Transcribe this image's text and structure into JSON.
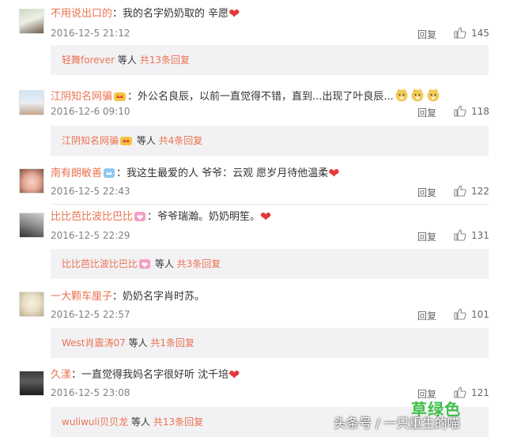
{
  "comments": [
    {
      "username": "不用说出口的",
      "text": "：我的名字奶奶取的  辛愿",
      "date": "2016-12-5 21:12",
      "reply_label": "回复",
      "likes": "145",
      "sub": {
        "name": "轻舞forever",
        "etc": " 等人 ",
        "count": "共13条回复"
      }
    },
    {
      "username": "江阴知名网骗",
      "text": "：外公名良辰，以前一直觉得不错，直到...出现了叶良辰...",
      "date": "2016-12-6 09:10",
      "reply_label": "回复",
      "likes": "118",
      "sub": {
        "name": "江阴知名网骗",
        "etc": " 等人 ",
        "count": "共4条回复"
      }
    },
    {
      "username": "南有朗敏善",
      "text": "：我这生最爱的人  爷爷：云观 愿岁月待他温柔",
      "date": "2016-12-5 22:43",
      "reply_label": "回复",
      "likes": "122"
    },
    {
      "username": "比比芭比波比巴比",
      "text": "：爷爷瑞瀚。奶奶明笙。",
      "date": "2016-12-5 22:29",
      "reply_label": "回复",
      "likes": "131",
      "sub": {
        "name": "比比芭比波比巴比",
        "etc": " 等人 ",
        "count": "共3条回复"
      }
    },
    {
      "username": "一大颗车厘子",
      "text": "：奶奶名字肖时苏。",
      "date": "2016-12-5 22:57",
      "reply_label": "回复",
      "likes": "101",
      "sub": {
        "name": "West肖震涛07",
        "etc": " 等人 ",
        "count": "共1条回复"
      }
    },
    {
      "username": "久漾",
      "text": "：一直觉得我妈名字很好听 沈千培",
      "date": "2016-12-5 23:08",
      "reply_label": "回复",
      "likes": "121",
      "sub": {
        "name": "wuliwuli贝贝龙",
        "etc": " 等人 ",
        "count": "共13条回复"
      }
    }
  ],
  "watermark": {
    "green": "草绿色",
    "text": "头条号 / 一只重生的喵"
  },
  "colors": {
    "username": "#eb7350",
    "heart": "#e4393c",
    "subbox_bg": "#f2f2f5",
    "watermark_green": "#3dbf48"
  },
  "icons": {
    "like": "thumbs-up-icon",
    "heart": "heart-icon",
    "vip": "crown-badge-icon",
    "member": "member-badge-icon",
    "emoji": "doge-emoji-icon"
  }
}
